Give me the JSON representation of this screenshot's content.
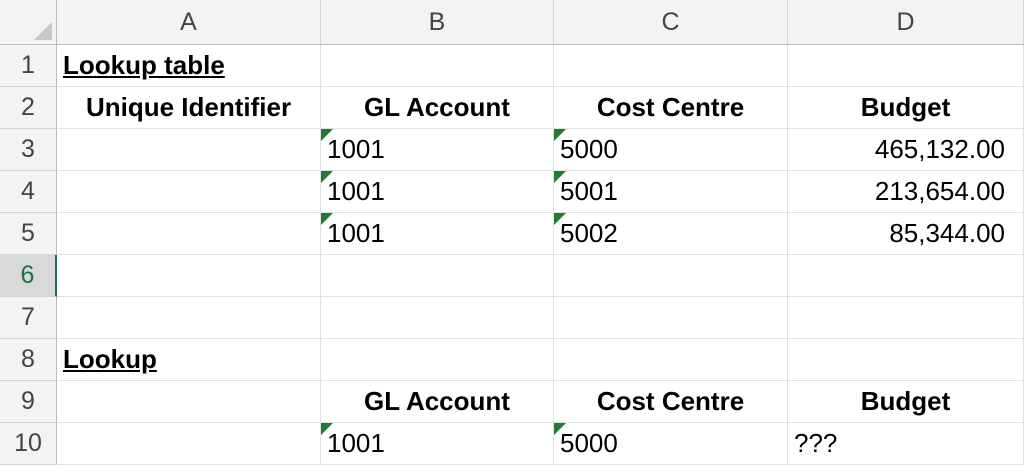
{
  "columns": [
    "A",
    "B",
    "C",
    "D"
  ],
  "rows": [
    "1",
    "2",
    "3",
    "4",
    "5",
    "6",
    "7",
    "8",
    "9",
    "10"
  ],
  "cells": {
    "A1": "Lookup table",
    "A2": "Unique Identifier",
    "B2": "GL Account",
    "C2": "Cost Centre",
    "D2": "Budget",
    "B3": "1001",
    "C3": "5000",
    "D3": "465,132.00",
    "B4": "1001",
    "C4": "5001",
    "D4": "213,654.00",
    "B5": "1001",
    "C5": "5002",
    "D5": "85,344.00",
    "A8": "Lookup",
    "B9": "GL Account",
    "C9": "Cost Centre",
    "D9": "Budget",
    "B10": "1001",
    "C10": "5000",
    "D10": "???"
  },
  "active_row": "6",
  "colors": {
    "active_accent": "#1e7145",
    "text_indicator": "#1e7d32",
    "header_bg": "#f3f3f3"
  }
}
